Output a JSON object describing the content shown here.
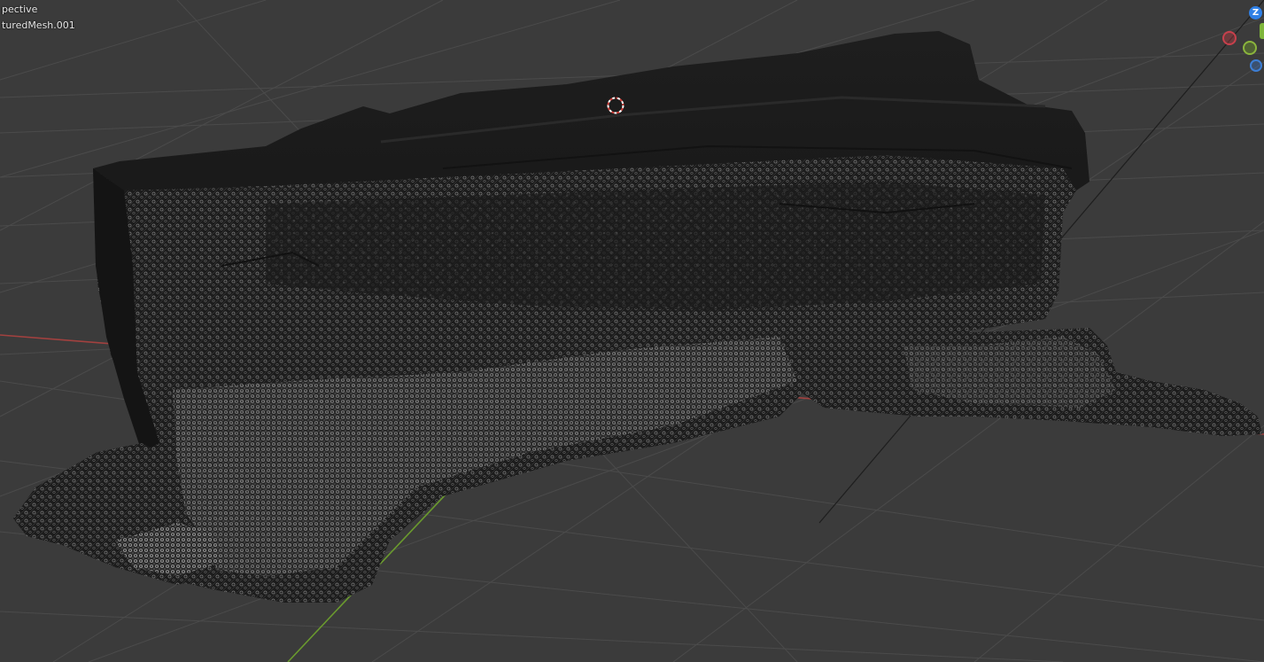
{
  "viewport": {
    "view_mode": "pective",
    "object_name": "turedMesh.001"
  },
  "gizmo": {
    "z_label": "Z",
    "x_color": "#c8404c",
    "y_color": "#8bb53c",
    "z_color": "#2f80e6"
  },
  "colors": {
    "background": "#3b3b3b",
    "grid": "#4a4a4a",
    "x_axis": "#a2413f",
    "y_axis": "#6a9a2e",
    "mesh": "#1b1b1b",
    "wire": "#9a9a9a"
  },
  "icons": {
    "cursor": "3d-cursor-icon"
  }
}
